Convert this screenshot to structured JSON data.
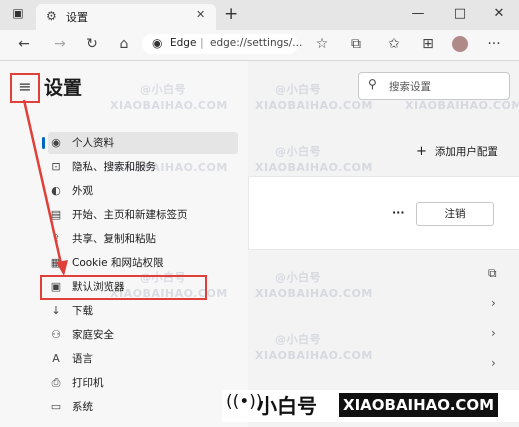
{
  "browser": {
    "tab_title": "设置",
    "new_tab": "+",
    "window_controls": {
      "minimize": "—",
      "maximize": "□",
      "close": "✕"
    },
    "address_site": "Edge",
    "address_url": "edge://settings/..."
  },
  "settings": {
    "title": "设置",
    "search_placeholder": "搜索设置",
    "add_profile": "添加用户配置",
    "more": "···",
    "signout_label": "注销",
    "menu_items": [
      {
        "label": "个人资料",
        "icon": "profile-icon"
      },
      {
        "label": "隐私、搜索和服务",
        "icon": "lock-icon"
      },
      {
        "label": "外观",
        "icon": "palette-icon"
      },
      {
        "label": "开始、主页和新建标签页",
        "icon": "home-page-icon"
      },
      {
        "label": "共享、复制和粘贴",
        "icon": "share-icon"
      },
      {
        "label": "Cookie 和网站权限",
        "icon": "cookie-icon"
      },
      {
        "label": "默认浏览器",
        "icon": "browser-icon"
      },
      {
        "label": "下载",
        "icon": "download-icon"
      },
      {
        "label": "家庭安全",
        "icon": "family-icon"
      },
      {
        "label": "语言",
        "icon": "language-icon"
      },
      {
        "label": "打印机",
        "icon": "printer-icon"
      },
      {
        "label": "系统",
        "icon": "system-icon"
      }
    ]
  },
  "watermark": {
    "cn": "@小白号",
    "en": "XIAOBAIHAO.COM"
  },
  "brand": {
    "cn": "小白号",
    "en": "XIAOBAIHAO.COM"
  },
  "colors": {
    "annotation_red": "#e0403a",
    "accent": "#0067c0"
  }
}
